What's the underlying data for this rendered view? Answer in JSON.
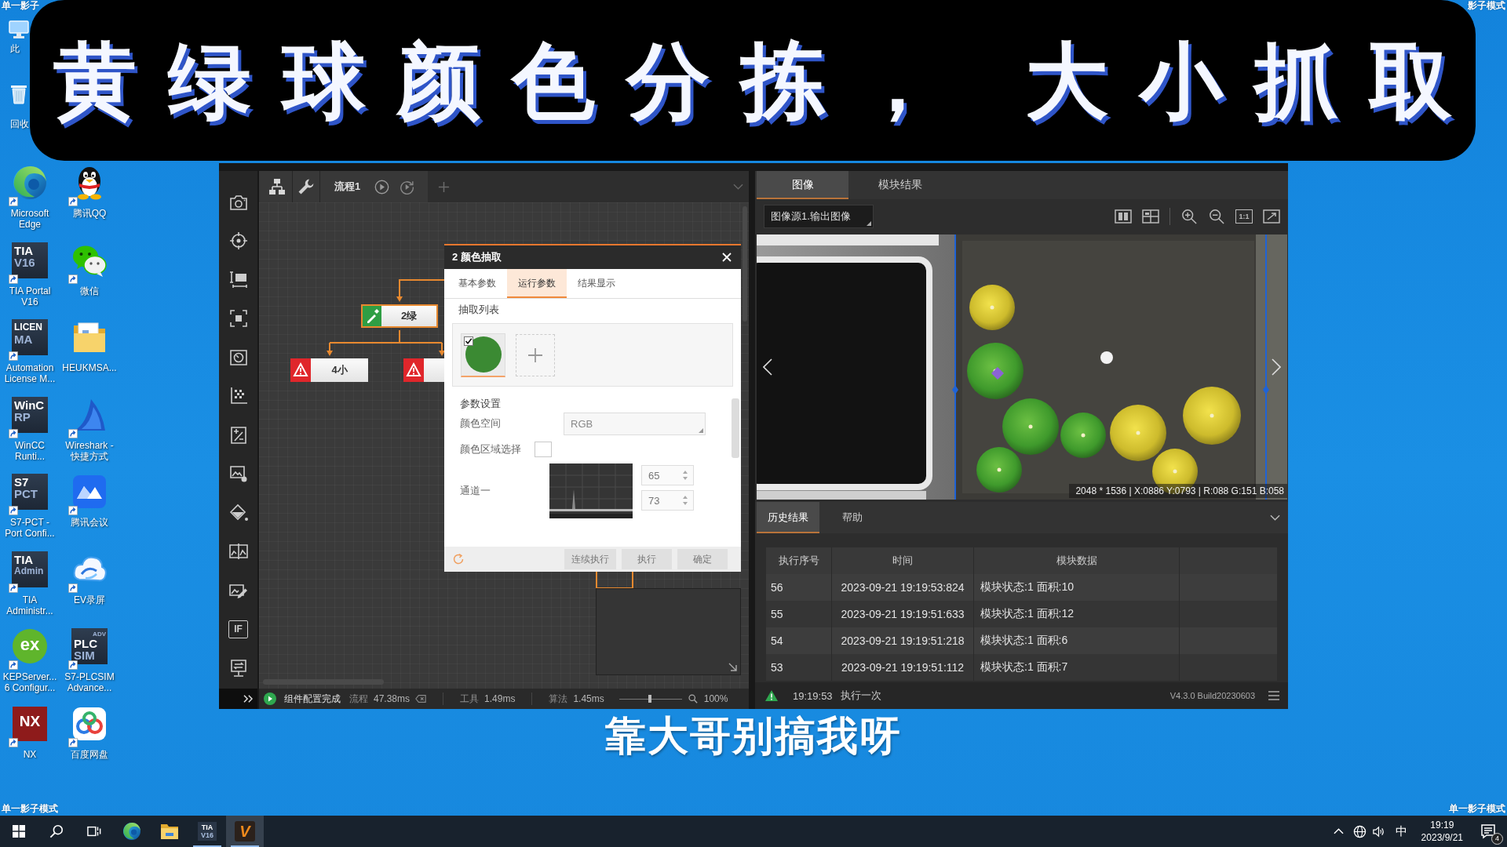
{
  "desktop": {
    "top_left_label": "单一影子",
    "top_right_label": "影子模式",
    "covered_icons": [
      {
        "kind": "computer",
        "label": "此"
      },
      {
        "kind": "recycle-bin",
        "label": "回收"
      }
    ],
    "icons": [
      {
        "kind": "swirl",
        "label": "Microsoft\nEdge",
        "shortcut": true
      },
      {
        "kind": "tile",
        "tile_lines": [
          "TIA",
          "V16"
        ],
        "label": "TIA Portal\nV16",
        "shortcut": true
      },
      {
        "kind": "tile",
        "tile_lines": [
          "LICEN",
          "MA"
        ],
        "label": "Automation\nLicense M...",
        "shortcut": true
      },
      {
        "kind": "tile",
        "tile_lines": [
          "WinC",
          "RP"
        ],
        "label": "WinCC\nRunti...",
        "shortcut": true
      },
      {
        "kind": "tile",
        "tile_lines": [
          "S7",
          "PCT"
        ],
        "label": "S7-PCT -\nPort Confi...",
        "shortcut": true
      },
      {
        "kind": "tile",
        "tile_lines": [
          "TIA",
          "Admin"
        ],
        "label": "TIA\nAdministr...",
        "shortcut": true
      },
      {
        "kind": "disc",
        "tile_lines": [
          "ex"
        ],
        "label": "KEPServer...\n6 Configur...",
        "shortcut": true
      },
      {
        "kind": "red-tile",
        "tile_lines": [
          "NX"
        ],
        "label": "NX",
        "shortcut": true
      },
      {
        "kind": "penguin",
        "label": "腾讯QQ",
        "shortcut": true
      },
      {
        "kind": "chat",
        "label": "微信",
        "shortcut": true
      },
      {
        "kind": "folder",
        "label": "HEUKMSA...",
        "shortcut": false
      },
      {
        "kind": "fin",
        "label": "Wireshark -\n快捷方式",
        "shortcut": true
      },
      {
        "kind": "meeting",
        "label": "腾讯会议",
        "shortcut": true
      },
      {
        "kind": "cloud",
        "label": "EV录屏",
        "shortcut": true
      },
      {
        "kind": "tile",
        "tile_corner": "ADV",
        "tile_lines": [
          "PLC",
          "SIM"
        ],
        "label": "S7-PLCSIM\nAdvance...",
        "shortcut": true
      },
      {
        "kind": "rings",
        "label": "百度网盘",
        "shortcut": true
      }
    ],
    "bottom_left_label": "单一影子模式",
    "bottom_right_label": "单一影子模式"
  },
  "banner": {
    "title": "黄绿球颜色分拣， 大小抓取"
  },
  "app": {
    "toolstrip": {
      "logic_tool": "IF"
    },
    "flow": {
      "tab": "流程1",
      "nodes": [
        {
          "kind": "extract",
          "label": "2绿"
        },
        {
          "kind": "alert",
          "label": "4小"
        },
        {
          "kind": "alert"
        }
      ]
    },
    "dialog": {
      "title": "2 颜色抽取",
      "tabs": [
        {
          "label": "基本参数",
          "selected": false
        },
        {
          "label": "运行参数",
          "selected": true
        },
        {
          "label": "结果显示",
          "selected": false
        }
      ],
      "list_heading": "抽取列表",
      "swatches": [
        {
          "color": "#3b8a33",
          "checked": true
        }
      ],
      "params_heading": "参数设置",
      "fields": [
        {
          "kind": "select",
          "label": "颜色空间",
          "value": "RGB"
        },
        {
          "kind": "checkbox",
          "label": "颜色区域选择",
          "checked": false
        },
        {
          "kind": "channel",
          "label": "通道一",
          "values": [
            "65",
            "73"
          ]
        }
      ],
      "buttons": [
        "连续执行",
        "执行",
        "确定"
      ]
    },
    "flow_status": {
      "message": "组件配置完成",
      "flow_label": "流程",
      "flow_time": "47.38ms",
      "tool_label": "工具",
      "tool_time": "1.49ms",
      "algo_label": "算法",
      "algo_time": "1.45ms",
      "zoom": {
        "level": 0.49,
        "reading": "100%"
      }
    },
    "view_tabs": [
      {
        "label": "图像",
        "selected": true
      },
      {
        "label": "模块结果",
        "selected": false
      }
    ],
    "image_source": "图像源1.输出图像",
    "actual_size": "1:1",
    "image_info": "2048 * 1536 | X:0886 Y:0793 | R:088 G:151 B:058",
    "result_tabs": [
      {
        "label": "历史结果",
        "selected": true
      },
      {
        "label": "帮助",
        "selected": false
      }
    ],
    "table": {
      "columns": [
        "执行序号",
        "时间",
        "模块数据"
      ],
      "rows": [
        [
          "56",
          "2023-09-21 19:19:53:824",
          "模块状态:1 面积:10"
        ],
        [
          "55",
          "2023-09-21 19:19:51:633",
          "模块状态:1 面积:12"
        ],
        [
          "54",
          "2023-09-21 19:19:51:218",
          "模块状态:1 面积:6"
        ],
        [
          "53",
          "2023-09-21 19:19:51:112",
          "模块状态:1 面积:7"
        ]
      ]
    },
    "status": {
      "time": "19:19:53",
      "action": "执行一次",
      "version": "V4.3.0 Build20230603"
    }
  },
  "subtitle": "靠大哥别搞我呀",
  "taskbar": {
    "apps": [
      {
        "kind": "swirl",
        "running": false,
        "selected": false
      },
      {
        "kind": "folder",
        "running": false,
        "selected": false
      },
      {
        "kind": "tile",
        "tile_lines": [
          "TIA",
          "V16"
        ],
        "running": true,
        "selected": false
      },
      {
        "kind": "v-logo",
        "tile_lines": [
          "V"
        ],
        "running": true,
        "selected": true
      }
    ],
    "tray": {
      "ime": "中",
      "time": "19:19",
      "date": "2023/9/21",
      "notifications": "4"
    }
  }
}
